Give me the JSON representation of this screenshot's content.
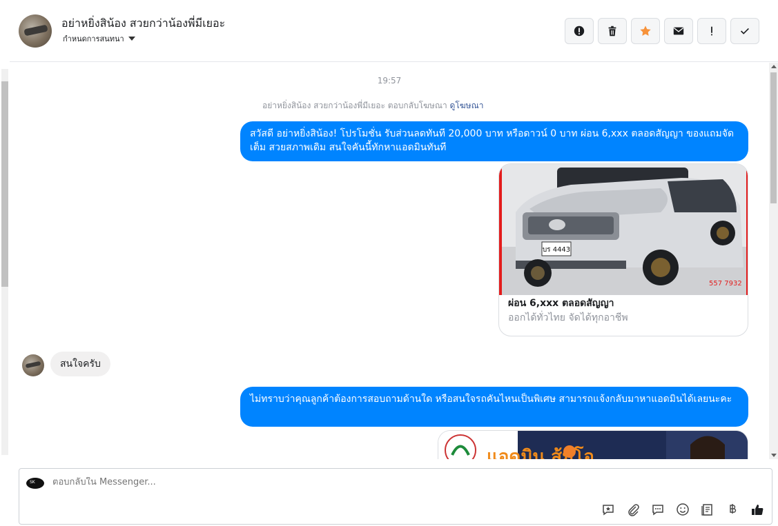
{
  "header": {
    "title": "อย่าหยิ่งสิน้อง สวยกว่าน้องพี่มีเยอะ",
    "subtitle": "กำหนดการสนทนา"
  },
  "actions": [
    {
      "name": "report-icon",
      "label": "!"
    },
    {
      "name": "trash-icon",
      "label": "delete"
    },
    {
      "name": "star-icon",
      "label": "star",
      "color": "#f7923a"
    },
    {
      "name": "envelope-icon",
      "label": "mail"
    },
    {
      "name": "exclamation-icon",
      "label": "!"
    },
    {
      "name": "check-icon",
      "label": "done"
    }
  ],
  "conversation": {
    "time": "19:57",
    "notice_text": "อย่าหยิ่งสิน้อง สวยกว่าน้องพี่มีเยอะ ตอบกลับโฆษณา",
    "notice_link": "ดูโฆษณา",
    "messages": [
      {
        "from": "page",
        "text": "สวัสดี อย่าหยิ่งสิน้อง! โปรโมชั่น รับส่วนลดทันที 20,000 บาท หรือดาวน์ 0 บาท ผ่อน 6,xxx ตลอดสัญญา ของแถมจัดเต็ม สวยสภาพเดิม สนใจคันนี้ทักหาแอดมินทันที"
      },
      {
        "from": "page",
        "card_title": "ผ่อน 6,xxx ตลอดสัญญา",
        "card_subtitle": "ออกได้ทั่วไทย จัดได้ทุกอาชีพ",
        "plate": "บร 4443",
        "phone": "557 7932"
      },
      {
        "from": "user",
        "text": "สนใจครับ"
      },
      {
        "from": "page",
        "text": "ไม่ทราบว่าคุณลูกค้าต้องการสอบถามด้านใด หรือสนใจรถคันไหนเป็นพิเศษ สามารถแจ้งกลับมาหาแอดมินได้เลยนะคะ"
      },
      {
        "from": "page",
        "banner_text": "แอดมิน ส้มโอ"
      }
    ]
  },
  "composer": {
    "placeholder": "ตอบกลับใน Messenger...",
    "tools": [
      "saved-reply-icon",
      "attachment-icon",
      "message-icon",
      "emoji-icon",
      "document-icon",
      "baht-icon",
      "like-icon"
    ]
  },
  "colors": {
    "accent": "#0084ff",
    "star": "#f7923a"
  }
}
